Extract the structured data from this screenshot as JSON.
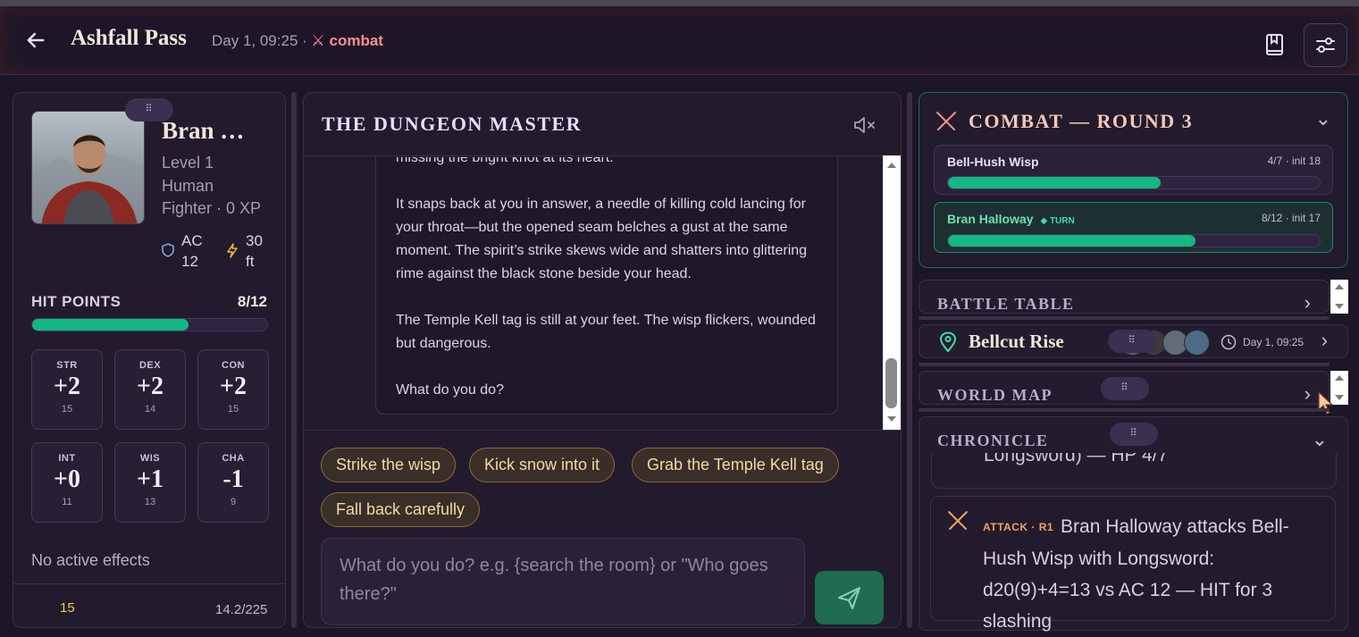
{
  "header": {
    "back_icon": "arrow-left-icon",
    "title": "Ashfall Pass",
    "time": "Day 1, 09:25 ·",
    "mode_icon": "crossed-swords-icon",
    "mode": "combat",
    "journal_icon": "book-icon",
    "settings_icon": "sliders-icon"
  },
  "character": {
    "name": "Bran …",
    "level": "Level 1",
    "race": "Human",
    "class_xp": "Fighter · 0 XP",
    "ac_label": "AC",
    "ac": "12",
    "speed": "30",
    "speed_unit": "ft",
    "hp_label": "HIT POINTS",
    "hp": "8/12",
    "hp_fraction": 0.667,
    "abilities": [
      {
        "label": "STR",
        "mod": "+2",
        "score": "15"
      },
      {
        "label": "DEX",
        "mod": "+2",
        "score": "14"
      },
      {
        "label": "CON",
        "mod": "+2",
        "score": "15"
      },
      {
        "label": "INT",
        "mod": "+0",
        "score": "11"
      },
      {
        "label": "WIS",
        "mod": "+1",
        "score": "13"
      },
      {
        "label": "CHA",
        "mod": "-1",
        "score": "9"
      }
    ],
    "effects": "No active effects",
    "footer": {
      "gold": "15",
      "weight": "14.2/225"
    }
  },
  "dm": {
    "title": "THE DUNGEON MASTER",
    "mute_icon": "speaker-mute-icon",
    "paragraphs": [
      "missing the bright knot at its heart.",
      "It snaps back at you in answer, a needle of killing cold lancing for your throat—but the opened seam belches a gust at the same moment. The spirit’s strike skews wide and shatters into glittering rime against the black stone beside your head.",
      "The Temple Kell tag is still at your feet. The wisp flickers, wounded but dangerous.",
      "What do you do?"
    ],
    "suggestions": [
      "Strike the wisp",
      "Kick snow into it",
      "Grab the Temple Kell tag",
      "Fall back carefully"
    ],
    "input_placeholder": "What do you do? e.g. {search the room} or \"Who goes there?\"",
    "send_icon": "send-icon"
  },
  "combat": {
    "title": "COMBAT — ROUND 3",
    "combatants": [
      {
        "name": "Bell-Hush Wisp",
        "meta": "4/7 · init 18",
        "hp_fraction": 0.571,
        "turn": ""
      },
      {
        "name": "Bran Halloway",
        "meta": "8/12 · init 17",
        "hp_fraction": 0.667,
        "turn": "◆ TURN"
      }
    ]
  },
  "panels": {
    "battle_table": "BATTLE TABLE",
    "world_map": "WORLD MAP",
    "chronicle": "CHRONICLE"
  },
  "location": {
    "name": "Bellcut Rise",
    "time": "Day 1, 09:25"
  },
  "chronicle": {
    "prev_entry_tail": "Longsword) — HP 4/7",
    "entry_tag": "ATTACK · R1",
    "entry_text": "Bran Halloway attacks Bell-Hush Wisp with Longsword: d20(9)+4=13 vs AC 12 — HIT for 3 slashing"
  },
  "colors": {
    "accent_green": "#13b883",
    "combat_red": "#ff8e8e",
    "chip_gold": "#f3d9a4"
  }
}
